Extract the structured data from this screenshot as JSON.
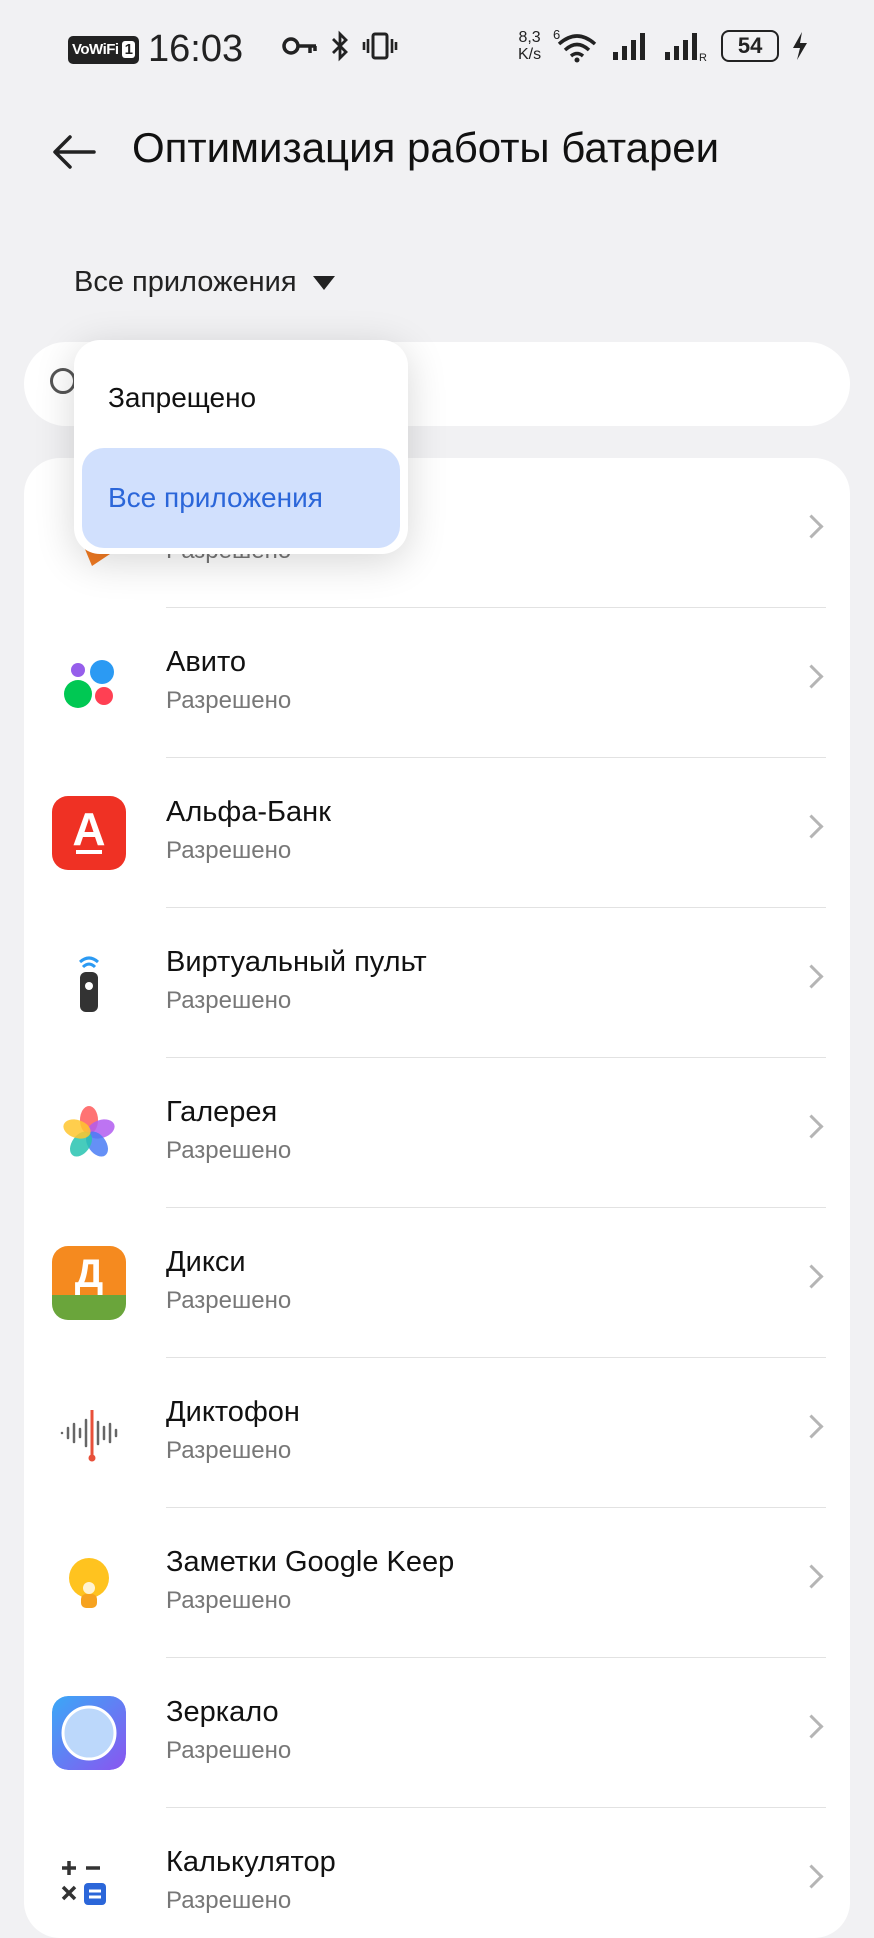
{
  "status_bar": {
    "vowifi": "VoWiFi",
    "sim": "1",
    "time": "16:03",
    "speed_value": "8,3",
    "speed_unit": "K/s",
    "wifi_gen": "6",
    "roaming": "R",
    "battery": "54"
  },
  "header": {
    "title": "Оптимизация работы батареи"
  },
  "filter": {
    "label": "Все приложения"
  },
  "dropdown": {
    "items": [
      "Запрещено",
      "Все приложения"
    ],
    "selected": "Все приложения"
  },
  "apps": [
    {
      "name": "",
      "status": "Разрешено",
      "icon": "orange-arrow-icon"
    },
    {
      "name": "Авито",
      "status": "Разрешено",
      "icon": "avito-icon"
    },
    {
      "name": "Альфа-Банк",
      "status": "Разрешено",
      "icon": "alfa-bank-icon"
    },
    {
      "name": "Виртуальный пульт",
      "status": "Разрешено",
      "icon": "remote-icon"
    },
    {
      "name": "Галерея",
      "status": "Разрешено",
      "icon": "gallery-icon"
    },
    {
      "name": "Дикси",
      "status": "Разрешено",
      "icon": "dixy-icon"
    },
    {
      "name": "Диктофон",
      "status": "Разрешено",
      "icon": "recorder-icon"
    },
    {
      "name": "Заметки Google Keep",
      "status": "Разрешено",
      "icon": "keep-icon"
    },
    {
      "name": "Зеркало",
      "status": "Разрешено",
      "icon": "mirror-icon"
    },
    {
      "name": "Калькулятор",
      "status": "Разрешено",
      "icon": "calculator-icon"
    }
  ],
  "icon_text": {
    "alfa": "А",
    "dixy": "Д"
  },
  "colors": {
    "accent": "#2b66d9",
    "selected_bg": "#d1e0fd",
    "alfa": "#ef3124",
    "dixy_top": "#f58a1f",
    "dixy_bottom": "#6aa53b",
    "mirror": "#6a7cf5"
  }
}
